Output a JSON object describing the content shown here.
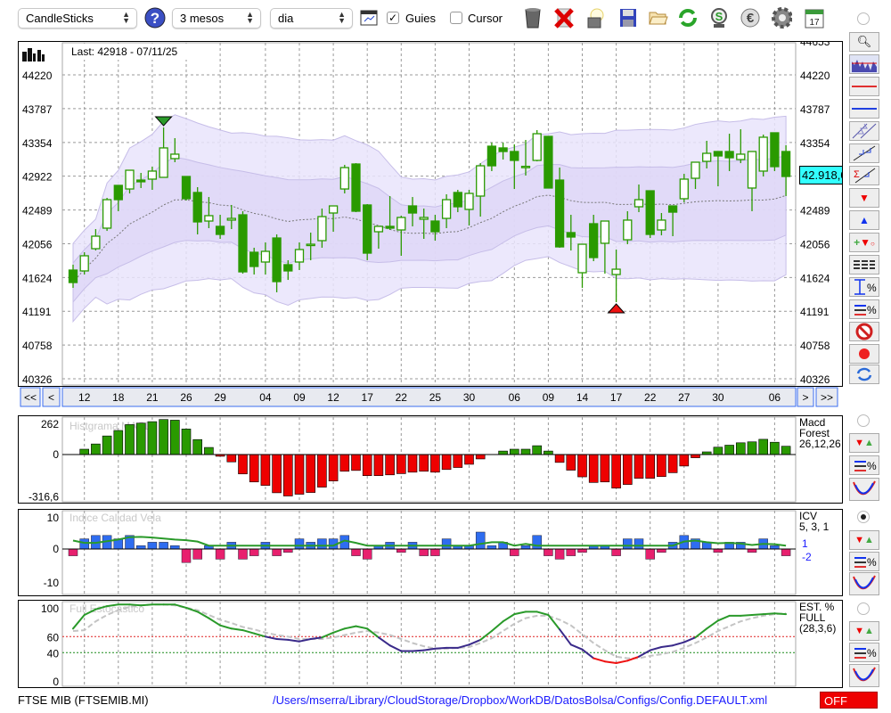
{
  "toolbar": {
    "chart_type": "CandleSticks",
    "period": "3 mesos",
    "interval": "dia",
    "guides_label": "Guies",
    "guides_checked": true,
    "cursor_label": "Cursor",
    "cursor_checked": false
  },
  "main": {
    "last_label": "Last: 42918 - 07/11/25",
    "price_tag": "42.918,00",
    "left_ticks": [
      "44220",
      "43787",
      "43354",
      "42922",
      "42489",
      "42056",
      "41624",
      "41191",
      "40758",
      "40326"
    ],
    "right_ticks": [
      "44653",
      "44220",
      "43787",
      "43354",
      "42489",
      "42056",
      "41624",
      "41191",
      "40758",
      "40326"
    ],
    "nav": {
      "first": "<<",
      "prev": "<",
      "next": ">",
      "last": ">>"
    }
  },
  "colors": {
    "up_body": "#ffffff",
    "candle": "#2a9a00",
    "band_outer": "#e9e4fb",
    "band_inner": "#ddd4f7",
    "price_tag": "#33ffff",
    "macd_pos": "#2a9a00",
    "macd_neg": "#ee0000",
    "icv_pos": "#2f6df0",
    "icv_neg": "#e8206e",
    "link": "#1a1aff",
    "off": "#ee0000"
  },
  "chart_data": [
    {
      "type": "candlestick",
      "title": "FTSE MIB daily",
      "ylim": [
        40326,
        44653
      ],
      "candles": [
        [
          41719,
          41788,
          41491,
          41559
        ],
        [
          41708,
          41947,
          41662,
          41902
        ],
        [
          41993,
          42244,
          41970,
          42153
        ],
        [
          42256,
          42644,
          42221,
          42621
        ],
        [
          42804,
          42804,
          42473,
          42621
        ],
        [
          42758,
          42998,
          42701,
          42998
        ],
        [
          42872,
          42964,
          42770,
          42850
        ],
        [
          42884,
          43044,
          42747,
          42987
        ],
        [
          42907,
          43546,
          42907,
          43284
        ],
        [
          43147,
          43409,
          43101,
          43204
        ],
        [
          42918,
          42918,
          42610,
          42633
        ],
        [
          42713,
          42781,
          42176,
          42336
        ],
        [
          42347,
          42655,
          42256,
          42416
        ],
        [
          42279,
          42427,
          42119,
          42176
        ],
        [
          42359,
          42553,
          42244,
          42381
        ],
        [
          42427,
          42473,
          41673,
          41696
        ],
        [
          41947,
          42005,
          41662,
          41765
        ],
        [
          41822,
          42073,
          41662,
          41959
        ],
        [
          42130,
          42176,
          41434,
          41571
        ],
        [
          41788,
          41845,
          41593,
          41708
        ],
        [
          41822,
          42073,
          41719,
          41982
        ],
        [
          42039,
          42199,
          41845,
          42050
        ],
        [
          42096,
          42507,
          42005,
          42404
        ],
        [
          42450,
          42541,
          42210,
          42541
        ],
        [
          42758,
          43067,
          42701,
          43032
        ],
        [
          43078,
          43089,
          42461,
          42473
        ],
        [
          42553,
          42564,
          41845,
          41936
        ],
        [
          42210,
          42279,
          41993,
          42279
        ],
        [
          42279,
          42667,
          42233,
          42256
        ],
        [
          42233,
          42416,
          41902,
          42393
        ],
        [
          42541,
          42655,
          42279,
          42450
        ],
        [
          42370,
          42507,
          42119,
          42393
        ],
        [
          42347,
          42427,
          42096,
          42210
        ],
        [
          42381,
          42690,
          42256,
          42621
        ],
        [
          42713,
          42747,
          42461,
          42530
        ],
        [
          42496,
          42747,
          42290,
          42701
        ],
        [
          42667,
          43089,
          42404,
          43055
        ],
        [
          43306,
          43352,
          42987,
          43055
        ],
        [
          43284,
          43352,
          43135,
          43238
        ],
        [
          43238,
          43329,
          42758,
          43124
        ],
        [
          43044,
          43386,
          42930,
          43048
        ],
        [
          43124,
          43512,
          43112,
          43466
        ],
        [
          43432,
          43432,
          42770,
          42770
        ],
        [
          42872,
          43032,
          42005,
          42016
        ],
        [
          42199,
          42427,
          41970,
          42142
        ],
        [
          41685,
          42050,
          41491,
          42050
        ],
        [
          42313,
          42427,
          41833,
          41879
        ],
        [
          42062,
          42347,
          41673,
          42347
        ],
        [
          41662,
          41982,
          41308,
          41730
        ],
        [
          42107,
          42473,
          42050,
          42359
        ],
        [
          42530,
          42815,
          42461,
          42621
        ],
        [
          42735,
          42735,
          42130,
          42176
        ],
        [
          42233,
          42450,
          42164,
          42359
        ],
        [
          42541,
          42541,
          42153,
          42461
        ],
        [
          42633,
          42952,
          42587,
          42884
        ],
        [
          42895,
          43101,
          42758,
          43101
        ],
        [
          43112,
          43375,
          43021,
          43215
        ],
        [
          43238,
          43238,
          42792,
          43181
        ],
        [
          43238,
          43466,
          42987,
          43158
        ],
        [
          43135,
          43523,
          43089,
          43204
        ],
        [
          42770,
          43238,
          42473,
          43238
        ],
        [
          42987,
          43455,
          42918,
          43421
        ],
        [
          43478,
          43478,
          42987,
          43044
        ],
        [
          43238,
          43318,
          42667,
          42918
        ]
      ],
      "date_labels": [
        {
          "index": 1,
          "label": "12"
        },
        {
          "index": 4,
          "label": "18"
        },
        {
          "index": 7,
          "label": "21"
        },
        {
          "index": 10,
          "label": "26"
        },
        {
          "index": 13,
          "label": "29"
        },
        {
          "index": 17,
          "label": "04"
        },
        {
          "index": 20,
          "label": "09"
        },
        {
          "index": 23,
          "label": "12"
        },
        {
          "index": 26,
          "label": "17"
        },
        {
          "index": 29,
          "label": "22"
        },
        {
          "index": 32,
          "label": "25"
        },
        {
          "index": 35,
          "label": "30"
        },
        {
          "index": 39,
          "label": "06"
        },
        {
          "index": 42,
          "label": "09"
        },
        {
          "index": 45,
          "label": "14"
        },
        {
          "index": 48,
          "label": "17"
        },
        {
          "index": 51,
          "label": "22"
        },
        {
          "index": 54,
          "label": "27"
        },
        {
          "index": 57,
          "label": "30"
        },
        {
          "index": 62,
          "label": "06"
        }
      ],
      "signals": [
        {
          "index": 8,
          "type": "sell"
        },
        {
          "index": 48,
          "type": "buy"
        }
      ],
      "bands": {
        "period": 20,
        "inner_sd": 1,
        "outer_sd": 2
      }
    },
    {
      "type": "bar",
      "title": "Histgrama MACD",
      "legend": [
        "Macd",
        "Forest",
        "26,12,26"
      ],
      "ticks": [
        {
          "value": 262,
          "label": "262"
        },
        {
          "value": 0,
          "label": "0"
        },
        {
          "value": -316.6,
          "label": "-316,6"
        }
      ],
      "values": [
        0,
        40,
        79,
        139,
        180,
        224,
        235,
        246,
        262,
        257,
        191,
        112,
        53,
        -13,
        -55,
        -145,
        -205,
        -231,
        -286,
        -310,
        -297,
        -284,
        -244,
        -198,
        -125,
        -119,
        -158,
        -158,
        -152,
        -143,
        -132,
        -125,
        -132,
        -112,
        -97,
        -73,
        -33,
        0,
        26,
        40,
        40,
        66,
        26,
        -59,
        -117,
        -167,
        -209,
        -205,
        -251,
        -224,
        -178,
        -178,
        -165,
        -136,
        -86,
        -24,
        20,
        55,
        70,
        88,
        95,
        114,
        92,
        62
      ]
    },
    {
      "type": "bar",
      "title": "Indice Calidad Vela",
      "legend": [
        "ICV",
        "5, 3, 1"
      ],
      "side_values": [
        "1",
        "-2"
      ],
      "ticks": [
        {
          "value": 10,
          "label": "10"
        },
        {
          "value": 0,
          "label": "0"
        },
        {
          "value": -10,
          "label": "-10"
        }
      ],
      "values": [
        -2,
        3,
        4,
        4,
        3,
        4,
        1,
        2,
        2,
        1,
        -4,
        -3,
        1,
        -3,
        2,
        -3,
        -2,
        2,
        -2,
        -1,
        3,
        2,
        3,
        3,
        4,
        -2,
        -3,
        1,
        2,
        -1,
        2,
        -2,
        -2,
        3,
        1,
        1,
        5,
        1,
        2,
        -2,
        1,
        4,
        -2,
        -3,
        -2,
        -1,
        1,
        1,
        -2,
        3,
        3,
        -3,
        -1,
        2,
        4,
        3,
        2,
        -1,
        2,
        2,
        -1,
        3,
        1,
        -2
      ],
      "line": [
        2.5,
        1.8,
        1.8,
        2.3,
        2.8,
        3.5,
        3.6,
        3.4,
        3.1,
        2.8,
        2.6,
        2.2,
        1,
        1,
        1,
        1,
        1,
        1,
        1,
        1,
        1,
        1,
        1,
        1,
        2.5,
        1.8,
        1,
        1,
        1,
        1,
        1,
        1,
        1,
        1,
        1,
        1,
        1.5,
        2,
        2,
        1,
        1.5,
        1,
        1,
        1,
        1,
        1,
        1,
        1,
        1,
        1,
        1,
        1,
        1,
        1,
        2.2,
        2.5,
        2,
        1.7,
        1.8,
        1.6,
        1.2,
        1.5,
        1.4,
        1
      ]
    },
    {
      "type": "line",
      "title": "Full Estocastico",
      "legend": [
        "EST. %",
        "FULL",
        "(28,3,6)"
      ],
      "ticks": [
        {
          "value": 100,
          "label": "100"
        },
        {
          "value": 60,
          "label": "60"
        },
        {
          "value": 40,
          "label": "40"
        },
        {
          "value": 0,
          "label": "0"
        }
      ],
      "levels": [
        60,
        40
      ],
      "ylim": [
        0,
        100
      ],
      "series": [
        {
          "name": "K",
          "values": [
            70,
            87,
            94,
            98,
            100,
            100,
            99,
            100,
            100,
            100,
            96,
            91,
            83,
            74,
            70,
            68,
            64,
            60,
            57,
            56,
            54,
            57,
            59,
            65,
            70,
            73,
            70,
            59,
            49,
            42,
            42,
            43,
            45,
            46,
            46,
            50,
            56,
            67,
            79,
            88,
            91,
            91,
            87,
            69,
            50,
            44,
            33,
            29,
            27,
            30,
            35,
            43,
            47,
            49,
            53,
            59,
            70,
            80,
            86,
            86,
            87,
            88,
            89,
            88
          ]
        },
        {
          "name": "D",
          "values": [
            67,
            68,
            79,
            87,
            93,
            97,
            99,
            100,
            100,
            99,
            96,
            93,
            87,
            81,
            77,
            72,
            69,
            65,
            62,
            60,
            57,
            57,
            57,
            59,
            62,
            65,
            67,
            65,
            62,
            57,
            52,
            48,
            45,
            45,
            46,
            47,
            52,
            58,
            67,
            76,
            83,
            86,
            86,
            81,
            74,
            63,
            52,
            43,
            35,
            33,
            33,
            36,
            38,
            41,
            46,
            52,
            59,
            67,
            73,
            79,
            83,
            86,
            88,
            89
          ]
        }
      ]
    }
  ],
  "status": {
    "symbol": "FTSE MIB (FTSEMIB.MI)",
    "config_path": "/Users/mserra/Library/CloudStorage/Dropbox/WorkDB/DatosBolsa/Configs/Config.DEFAULT.xml",
    "mode": "OFF"
  }
}
